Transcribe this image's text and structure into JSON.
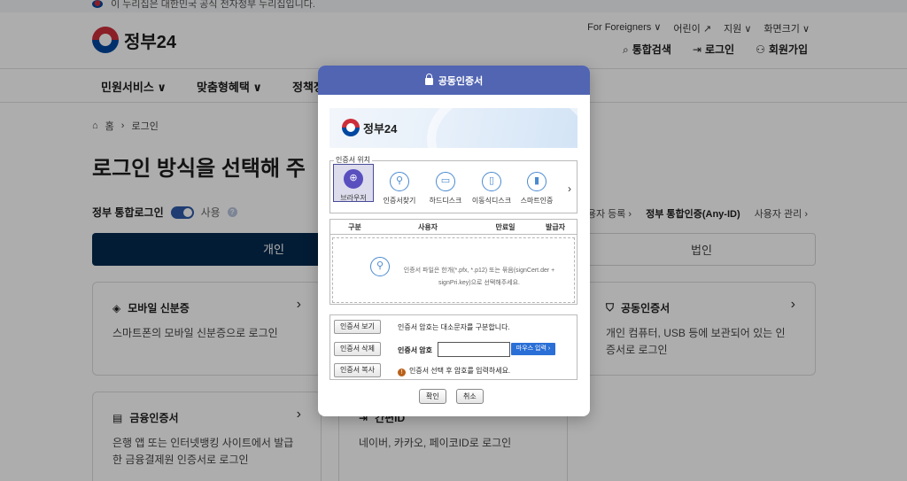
{
  "topstrip": {
    "text": "이 누리집은 대한민국 공식 전자정부 누리집입니다."
  },
  "header": {
    "logo_text": "정부24",
    "util": [
      "For Foreigners ∨",
      "어린이 ↗",
      "지원 ∨",
      "화면크기 ∨"
    ],
    "search": "통합검색",
    "login": "로그인",
    "signup": "회원가입"
  },
  "gnb": {
    "items": [
      "민원서비스 ∨",
      "맞춤형혜택 ∨",
      "정책정"
    ]
  },
  "breadcrumb": {
    "home": "홈",
    "current": "로그인"
  },
  "page": {
    "title": "로그인 방식을 선택해 주",
    "integrated_label": "정부 통합로그인",
    "use_label": "사용",
    "link_register": "사용자 등록 ›",
    "link_anyid": "정부 통합인증(Any-ID)",
    "link_manage": "사용자 관리 ›",
    "tab_personal": "개인",
    "tab_corp": "법인"
  },
  "cards": {
    "mobile": {
      "title": "모바일 신분증",
      "desc": "스마트폰의 모바일 신분증으로 로그인"
    },
    "public": {
      "title": "공동인증서",
      "desc": "개인 컴퓨터, USB 등에 보관되어 있는 인증서로 로그인"
    },
    "finance": {
      "title": "금융인증서",
      "desc": "은행 앱 또는 인터넷뱅킹 사이트에서 발급한 금융결제원 인증서로 로그인"
    },
    "simple": {
      "title": "간편ID",
      "desc": "네이버, 카카오, 페이코ID로 로그인"
    }
  },
  "modal": {
    "title": "공동인증서",
    "banner_logo": "정부24",
    "location_legend": "인증서 위치",
    "locations": [
      "브라우저",
      "인증서찾기",
      "하드디스크",
      "이동식디스크",
      "스마트인증"
    ],
    "table_headers": [
      "구분",
      "사용자",
      "만료일",
      "발급자"
    ],
    "dropzone_text": "인증서 파일은 한개(*.pfx, *.p12) 또는 묶음(signCert.der + signPri.key)으로 선택해주세요.",
    "btn_view": "인증서 보기",
    "btn_delete": "인증서 삭제",
    "btn_copy": "인증서 복사",
    "note_case": "인증서 암호는 대소문자를 구분합니다.",
    "pw_label": "인증서 암호",
    "pw_value": "",
    "mouse_input": "마우스 입력 ›",
    "note_warn": "인증서 선택 후 암호를 입력하세요.",
    "confirm": "확인",
    "cancel": "취소"
  },
  "colors": {
    "navy": "#052a4f",
    "modal_header": "#5165b2",
    "accent_blue": "#2a6fd6"
  }
}
